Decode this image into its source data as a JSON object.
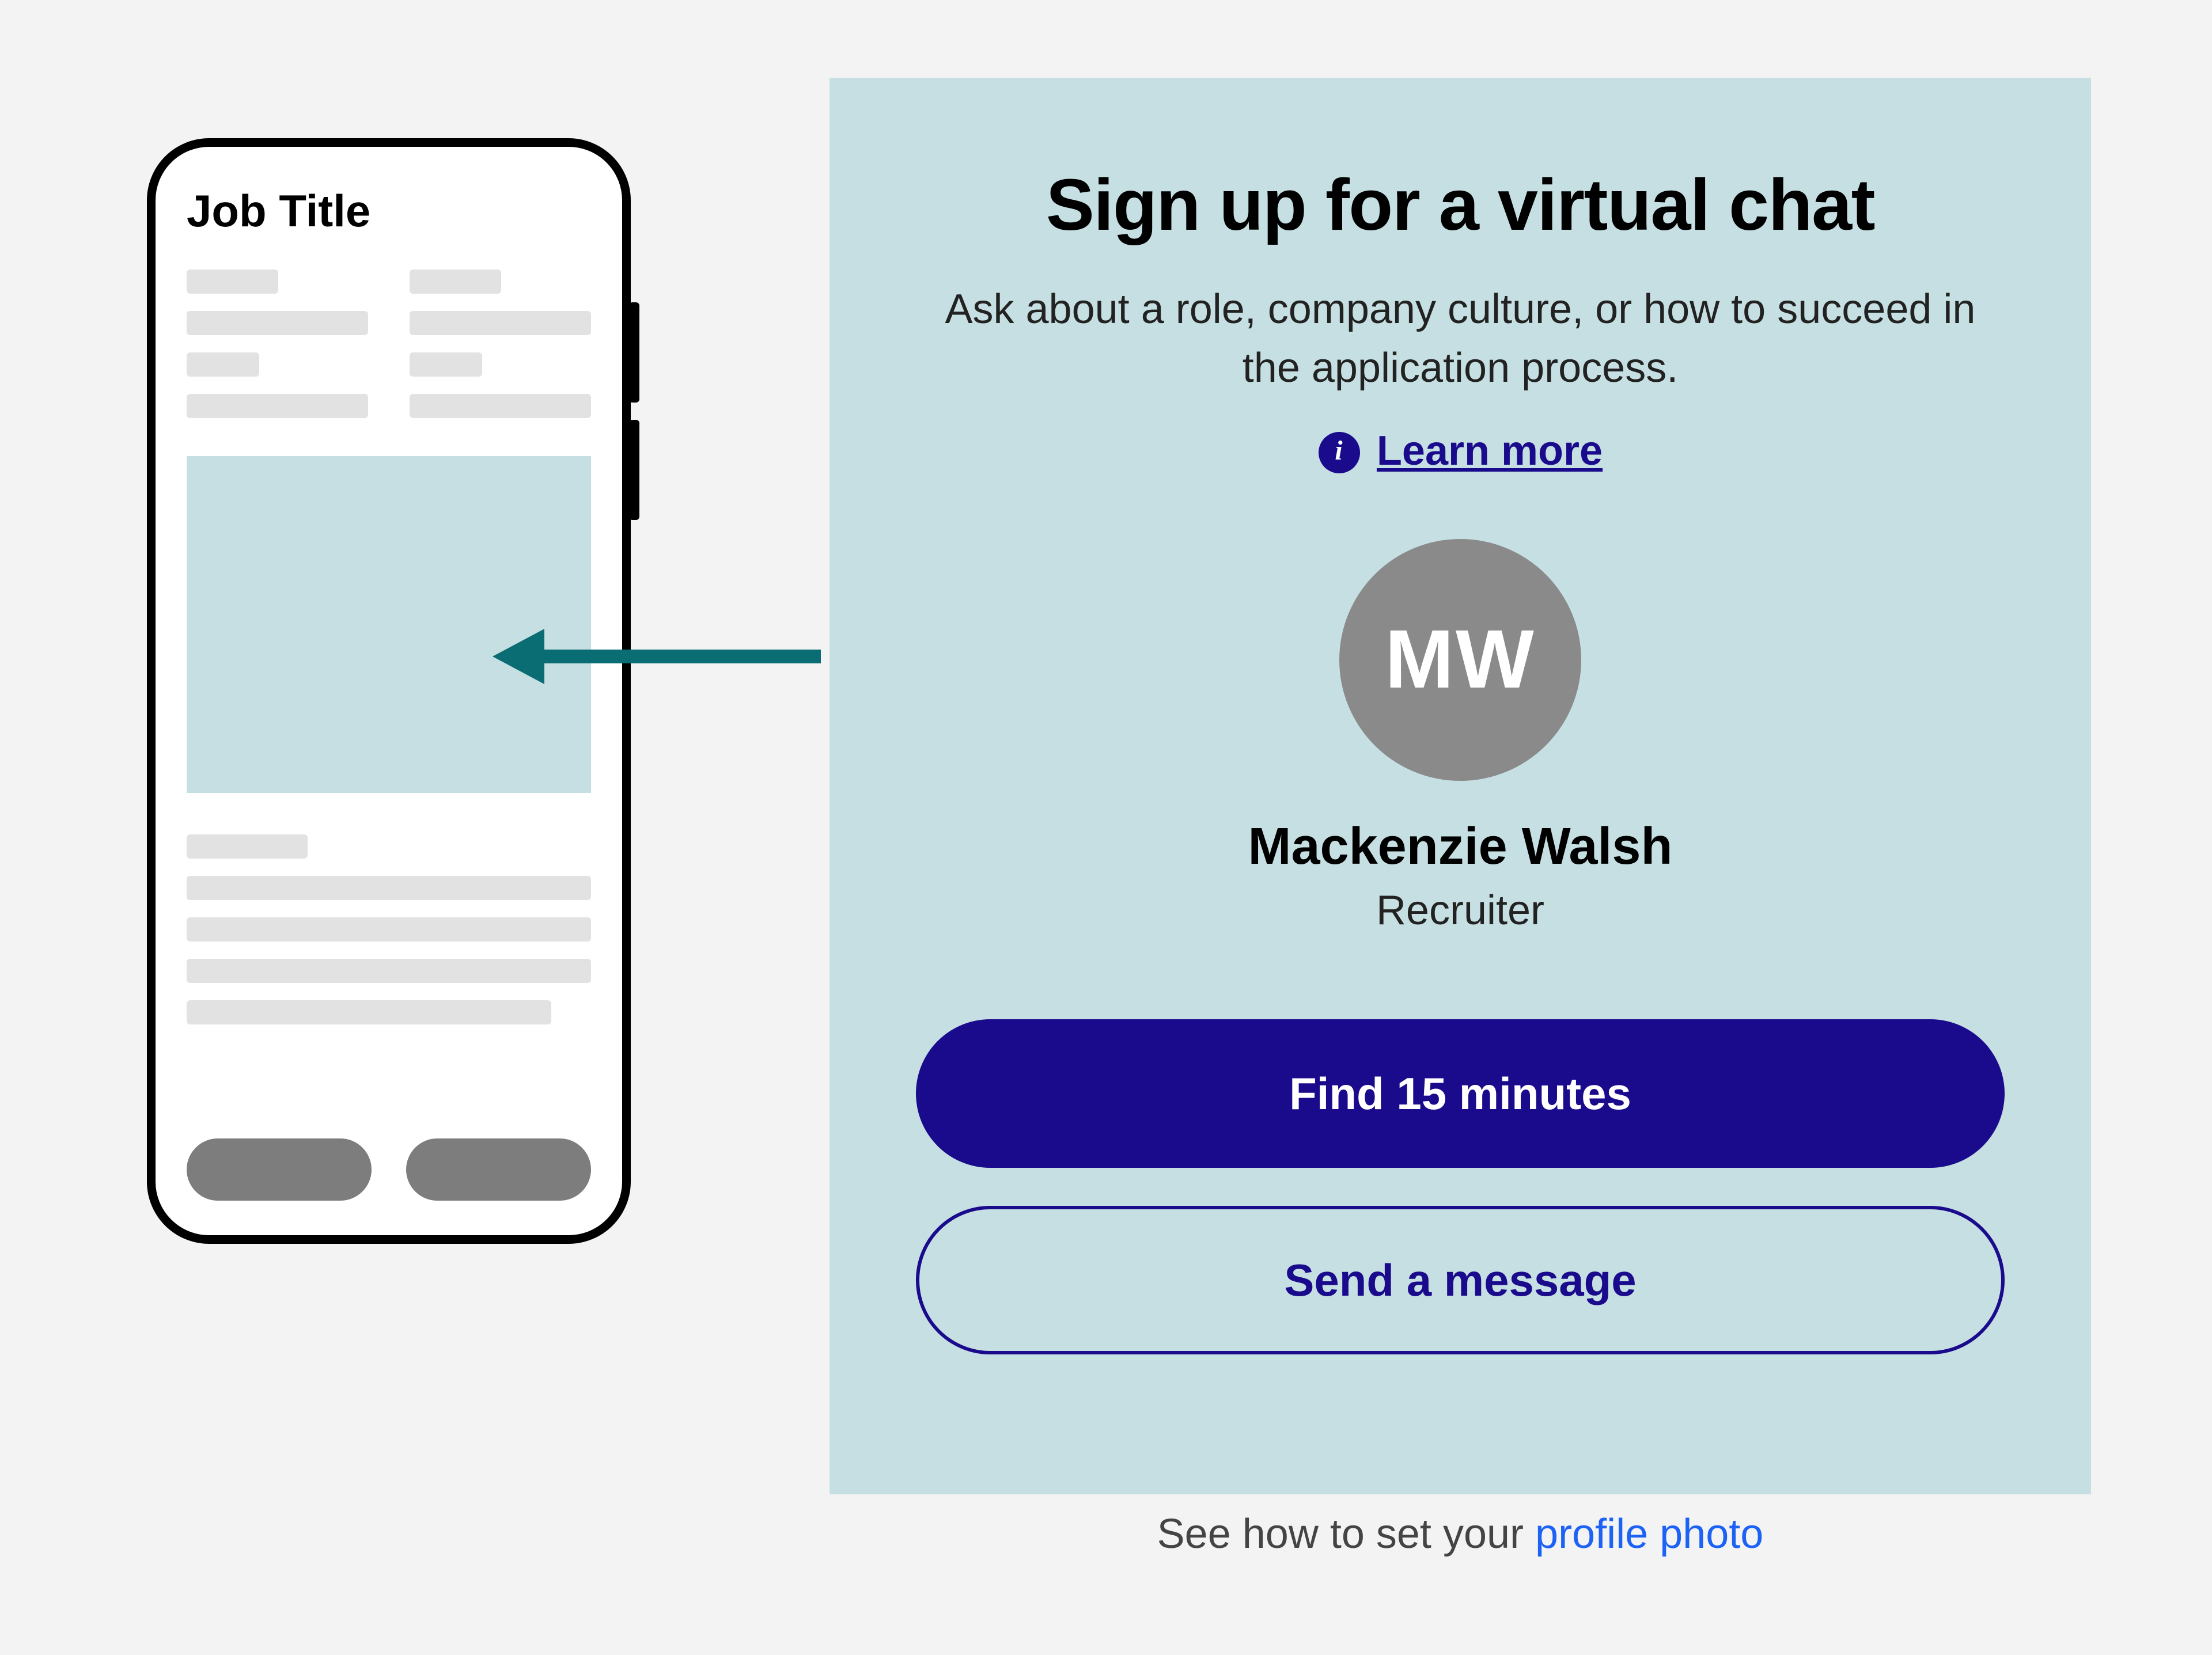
{
  "phone": {
    "title": "Job Title"
  },
  "card": {
    "heading": "Sign up for a virtual chat",
    "subheading": "Ask about a role, company culture, or how to succeed in the application process.",
    "learn_more_label": "Learn more",
    "avatar_initials": "MW",
    "person_name": "Mackenzie Walsh",
    "person_role": "Recruiter",
    "primary_button": "Find 15 minutes",
    "secondary_button": "Send a message"
  },
  "caption": {
    "prefix": "See how to set your ",
    "link_label": "profile photo"
  },
  "colors": {
    "card_bg": "#c6dfe2",
    "brand": "#1a0a8c",
    "arrow": "#0a6d74",
    "link_blue": "#1c62f5"
  }
}
